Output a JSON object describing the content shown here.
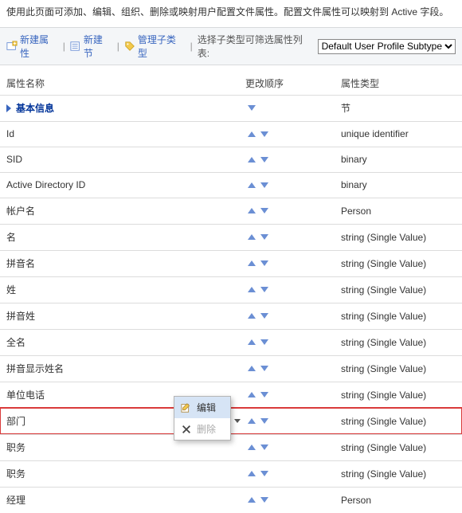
{
  "intro": "使用此页面可添加、编辑、组织、删除或映射用户配置文件属性。配置文件属性可以映射到 Active 字段。",
  "toolbar": {
    "newProperty": "新建属性",
    "newSection": "新建节",
    "manageSubTypes": "管理子类型",
    "filterLabel": "选择子类型可筛选属性列表:",
    "filterSelected": "Default User Profile Subtype"
  },
  "headers": {
    "name": "属性名称",
    "order": "更改顺序",
    "type": "属性类型"
  },
  "sectionTypeLabel": "节",
  "section": {
    "label": "基本信息"
  },
  "rows": [
    {
      "name": "Id",
      "type": "unique identifier"
    },
    {
      "name": "SID",
      "type": "binary"
    },
    {
      "name": "Active Directory ID",
      "type": "binary"
    },
    {
      "name": "帐户名",
      "type": "Person"
    },
    {
      "name": "名",
      "type": "string (Single Value)"
    },
    {
      "name": "拼音名",
      "type": "string (Single Value)"
    },
    {
      "name": "姓",
      "type": "string (Single Value)"
    },
    {
      "name": "拼音姓",
      "type": "string (Single Value)"
    },
    {
      "name": "全名",
      "type": "string (Single Value)"
    },
    {
      "name": "拼音显示姓名",
      "type": "string (Single Value)"
    },
    {
      "name": "单位电话",
      "type": "string (Single Value)"
    },
    {
      "name": "部门",
      "type": "string (Single Value)",
      "highlight": true,
      "hasMenu": true
    },
    {
      "name": "职务",
      "type": "string (Single Value)"
    },
    {
      "name": "职务",
      "type": "string (Single Value)"
    },
    {
      "name": "经理",
      "type": "Person"
    }
  ],
  "contextMenu": {
    "edit": "编辑",
    "delete": "删除"
  }
}
